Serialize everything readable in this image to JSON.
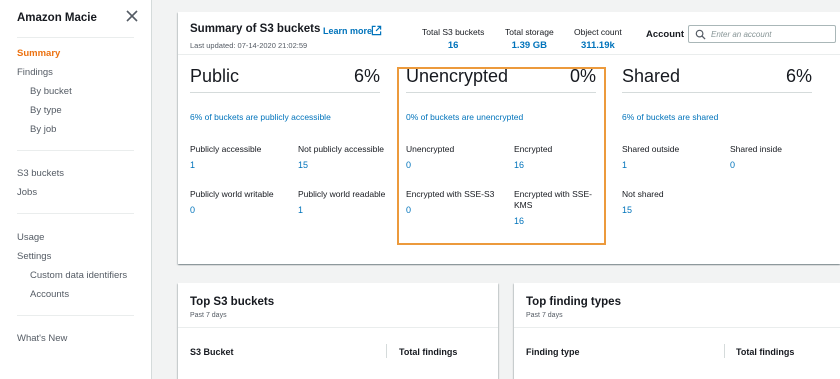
{
  "sidebar": {
    "title": "Amazon Macie",
    "group1": [
      "Summary",
      "Findings",
      "By bucket",
      "By type",
      "By job"
    ],
    "group2": [
      "S3 buckets",
      "Jobs"
    ],
    "group3": [
      "Usage",
      "Settings",
      "Custom data identifiers",
      "Accounts"
    ],
    "group4": [
      "What's New"
    ]
  },
  "summary": {
    "title": "Summary of S3 buckets",
    "learn_more": "Learn more",
    "last_updated": "Last updated: 07-14-2020 21:02:59",
    "stats": [
      {
        "label": "Total S3 buckets",
        "value": "16"
      },
      {
        "label": "Total storage",
        "value": "1.39 GB"
      },
      {
        "label": "Object count",
        "value": "311.19k"
      }
    ],
    "account_label": "Account",
    "account_placeholder": "Enter an account",
    "columns": [
      {
        "name": "Public",
        "percent": "6%",
        "link": "6% of buckets are publicly accessible",
        "metrics": [
          {
            "label": "Publicly accessible",
            "value": "1"
          },
          {
            "label": "Not publicly accessible",
            "value": "15"
          },
          {
            "label": "Publicly world writable",
            "value": "0"
          },
          {
            "label": "Publicly world readable",
            "value": "1"
          }
        ]
      },
      {
        "name": "Unencrypted",
        "percent": "0%",
        "link": "0% of buckets are unencrypted",
        "metrics": [
          {
            "label": "Unencrypted",
            "value": "0"
          },
          {
            "label": "Encrypted",
            "value": "16"
          },
          {
            "label": "Encrypted with SSE-S3",
            "value": "0"
          },
          {
            "label": "Encrypted with SSE-KMS",
            "value": "16"
          }
        ]
      },
      {
        "name": "Shared",
        "percent": "6%",
        "link": "6% of buckets are shared",
        "metrics": [
          {
            "label": "Shared outside",
            "value": "1"
          },
          {
            "label": "Shared inside",
            "value": "0"
          },
          {
            "label": "Not shared",
            "value": "15"
          }
        ]
      }
    ]
  },
  "top_buckets": {
    "title": "Top S3 buckets",
    "subtitle": "Past 7 days",
    "columns": [
      "S3 Bucket",
      "Total findings"
    ]
  },
  "top_findings": {
    "title": "Top finding types",
    "subtitle": "Past 7 days",
    "columns": [
      "Finding type",
      "Total findings"
    ]
  },
  "colors": {
    "accent": "#ec7211",
    "link": "#0073bb",
    "highlight_border": "#ec9a3c"
  },
  "icons": {
    "close": "close-icon",
    "external": "external-link-icon",
    "search": "search-icon"
  }
}
